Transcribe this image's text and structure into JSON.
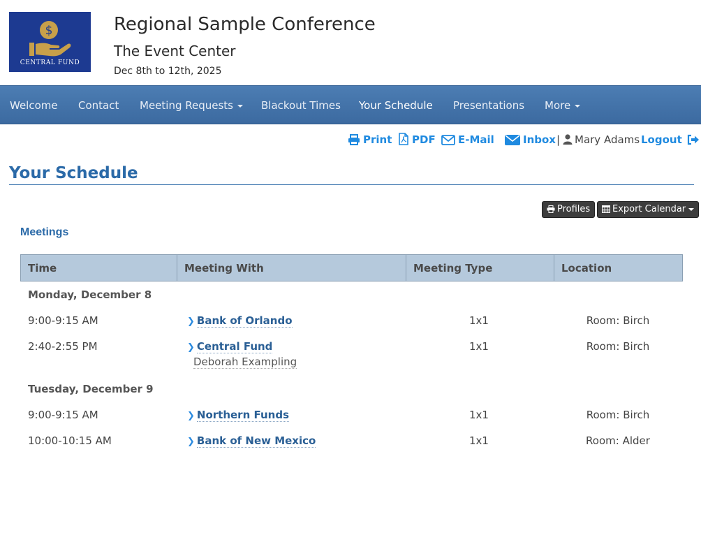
{
  "header": {
    "logo_text": "CENTRAL FUND",
    "title": "Regional Sample Conference",
    "venue": "The Event Center",
    "dates": "Dec 8th to 12th, 2025"
  },
  "nav": {
    "items": [
      "Welcome",
      "Contact",
      "Meeting Requests",
      "Blackout Times",
      "Your Schedule",
      "Presentations",
      "More"
    ],
    "active": "Your Schedule"
  },
  "utility": {
    "print": "Print",
    "pdf": "PDF",
    "email": "E-Mail",
    "inbox": "Inbox",
    "separator": "|",
    "user": "Mary Adams",
    "logout": "Logout"
  },
  "page": {
    "title": "Your Schedule",
    "profiles_button": "Profiles",
    "export_button": "Export Calendar",
    "section": "Meetings"
  },
  "table": {
    "headers": [
      "Time",
      "Meeting With",
      "Meeting Type",
      "Location"
    ],
    "days": [
      {
        "label": "Monday, December 8",
        "rows": [
          {
            "time": "9:00-9:15 AM",
            "with": "Bank of Orlando",
            "contact": "",
            "type": "1x1",
            "location": "Room: Birch"
          },
          {
            "time": "2:40-2:55 PM",
            "with": "Central Fund",
            "contact": "Deborah Exampling",
            "type": "1x1",
            "location": "Room: Birch"
          }
        ]
      },
      {
        "label": "Tuesday, December 9",
        "rows": [
          {
            "time": "9:00-9:15 AM",
            "with": "Northern Funds",
            "contact": "",
            "type": "1x1",
            "location": "Room: Birch"
          },
          {
            "time": "10:00-10:15 AM",
            "with": "Bank of New Mexico",
            "contact": "",
            "type": "1x1",
            "location": "Room: Alder"
          }
        ]
      }
    ]
  },
  "colors": {
    "accent": "#2b6aa8",
    "link": "#1f8ae0",
    "nav": "#4274aa",
    "table_header": "#b5c9dc",
    "logo_bg": "#1d3a91",
    "logo_gold": "#c8a04a"
  }
}
